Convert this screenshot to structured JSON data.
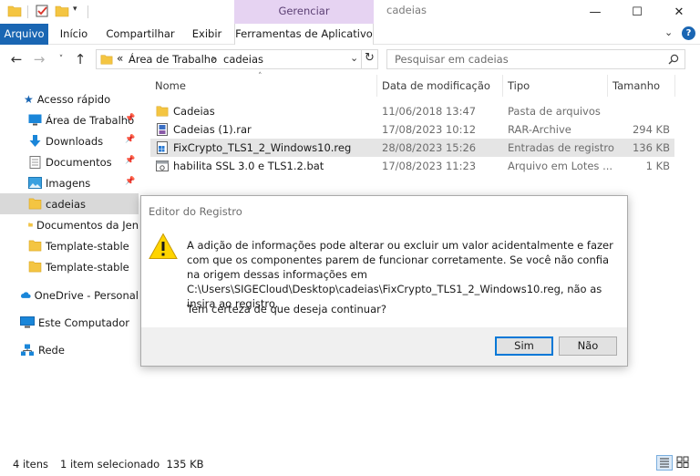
{
  "window": {
    "title": "cadeias",
    "manage_context": "Gerenciar",
    "controls": {
      "minimize": "—",
      "maximize": "☐",
      "close": "✕"
    }
  },
  "ribbon": {
    "tabs": [
      {
        "label": "Arquivo"
      },
      {
        "label": "Início"
      },
      {
        "label": "Compartilhar"
      },
      {
        "label": "Exibir"
      },
      {
        "label": "Ferramentas de Aplicativo"
      }
    ],
    "expand_glyph": "⌄",
    "help_glyph": "?"
  },
  "address": {
    "overflow": "«",
    "crumbs": [
      "Área de Trabalho",
      "cadeias"
    ],
    "separator": "›"
  },
  "search": {
    "placeholder": "Pesquisar em cadeias"
  },
  "sidebar": {
    "items": [
      {
        "label": "Acesso rápido"
      },
      {
        "label": "Área de Trabalho"
      },
      {
        "label": "Downloads"
      },
      {
        "label": "Documentos"
      },
      {
        "label": "Imagens"
      },
      {
        "label": "cadeias"
      },
      {
        "label": "Documentos da Jen"
      },
      {
        "label": "Template-stable"
      },
      {
        "label": "Template-stable"
      },
      {
        "label": "OneDrive - Personal"
      },
      {
        "label": "Este Computador"
      },
      {
        "label": "Rede"
      }
    ]
  },
  "filelist": {
    "columns": [
      "Nome",
      "Data de modificação",
      "Tipo",
      "Tamanho"
    ],
    "rows": [
      {
        "name": "Cadeias",
        "date": "11/06/2018 13:47",
        "type": "Pasta de arquivos",
        "size": ""
      },
      {
        "name": "Cadeias (1).rar",
        "date": "17/08/2023 10:12",
        "type": "RAR-Archive",
        "size": "294 KB"
      },
      {
        "name": "FixCrypto_TLS1_2_Windows10.reg",
        "date": "28/08/2023 15:26",
        "type": "Entradas de registro",
        "size": "136 KB"
      },
      {
        "name": "habilita SSL 3.0 e TLS1.2.bat",
        "date": "17/08/2023 11:23",
        "type": "Arquivo em Lotes ...",
        "size": "1 KB"
      }
    ]
  },
  "status": {
    "count": "4 itens",
    "selection": "1 item selecionado  135 KB"
  },
  "dialog": {
    "title": "Editor do Registro",
    "message": "A adição de informações pode alterar ou excluir um valor acidentalmente e fazer com que os componentes parem de funcionar corretamente. Se você não confia na origem dessas informações em C:\\Users\\SIGECloud\\Desktop\\cadeias\\FixCrypto_TLS1_2_Windows10.reg, não as insira ao registro.",
    "question": "Tem certeza de que deseja continuar?",
    "yes": "Sim",
    "no": "Não"
  },
  "colors": {
    "accent": "#1a66b3",
    "manage_tint": "#e6d3f2",
    "selection": "#e5e5e5",
    "folder": "#f4c542",
    "warning": "#ffd400"
  }
}
